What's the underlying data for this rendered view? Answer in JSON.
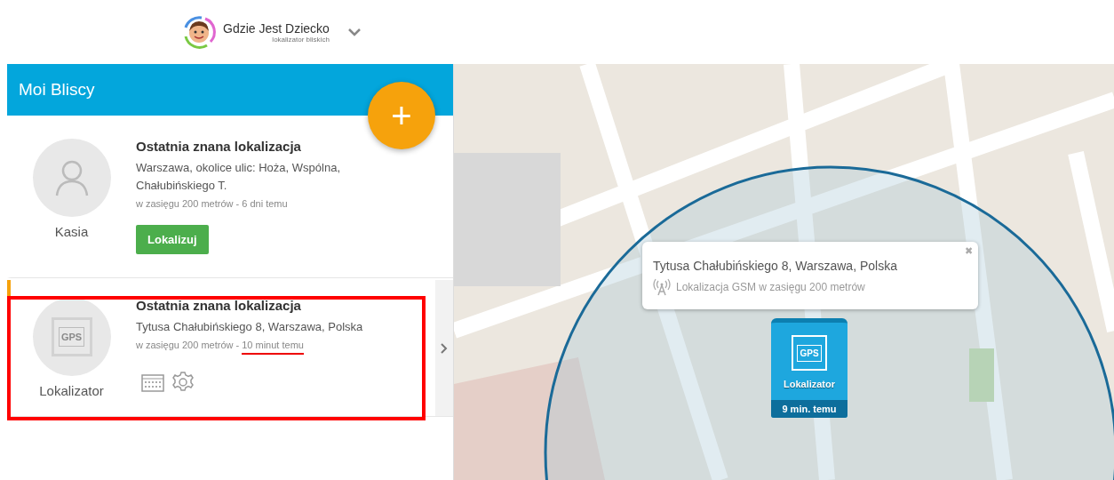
{
  "brand": {
    "name": "Gdzie Jest Dziecko",
    "tagline": "lokalizator bliskich"
  },
  "sidebar": {
    "title": "Moi Bliscy",
    "add_button": "+",
    "people": [
      {
        "kind": "person",
        "name": "Kasia",
        "selected": false,
        "heading": "Ostatnia znana lokalizacja",
        "address": "Warszawa, okolice ulic: Hoża, Wspólna, Chałubińskiego T.",
        "range": "w zasięgu 200 metrów - ",
        "time": "6 dni temu",
        "action": "Lokalizuj"
      },
      {
        "kind": "gps",
        "name": "Lokalizator",
        "selected": true,
        "heading": "Ostatnia znana lokalizacja",
        "address": "Tytusa Chałubińskiego 8, Warszawa, Polska",
        "range": "w zasięgu 200 metrów - ",
        "time": "10 minut temu",
        "icon_text": "GPS"
      }
    ]
  },
  "map": {
    "popup": {
      "close": "✖",
      "address": "Tytusa Chałubińskiego 8, Warszawa, Polska",
      "detail": "Lokalizacja GSM w zasięgu 200 metrów"
    },
    "marker": {
      "icon_text": "GPS",
      "name": "Lokalizator",
      "time": "9 min. temu"
    }
  }
}
